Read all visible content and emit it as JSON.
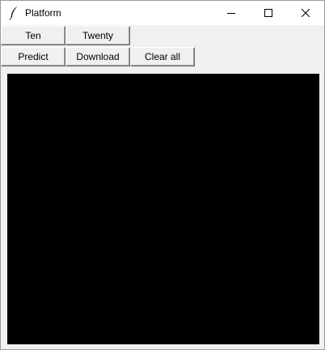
{
  "window": {
    "title": "Platform",
    "icon": "feather-icon",
    "controls": [
      "minimize-icon",
      "maximize-icon",
      "close-icon"
    ]
  },
  "toolbar": {
    "row1": [
      {
        "label": "Ten"
      },
      {
        "label": "Twenty"
      }
    ],
    "row2": [
      {
        "label": "Predict"
      },
      {
        "label": "Download"
      },
      {
        "label": "Clear all"
      }
    ]
  },
  "canvas": {
    "background": "#000000"
  }
}
